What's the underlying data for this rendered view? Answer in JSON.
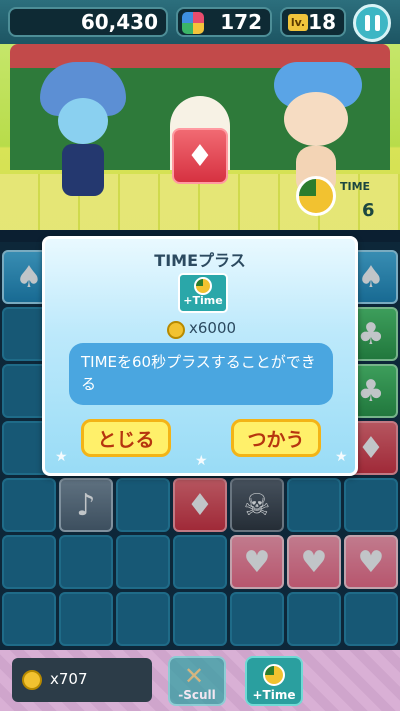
{
  "hud": {
    "score": "60,430",
    "gems": "172",
    "level_tag": "lv.",
    "level": "18"
  },
  "scene": {
    "time_label": "TIME",
    "time_value": "6",
    "tile_symbol": "♦"
  },
  "dialog": {
    "title": "TIMEプラス",
    "item_label": "+Time",
    "cost": "x6000",
    "message": "TIMEを60秒プラスすることができる",
    "close_label": "とじる",
    "use_label": "つかう"
  },
  "board": {
    "pieces": [
      {
        "col": 0,
        "row": 0,
        "kind": "p-blue",
        "symbol": "♠"
      },
      {
        "col": 6,
        "row": 0,
        "kind": "p-blue",
        "symbol": "♠"
      },
      {
        "col": 6,
        "row": 1,
        "kind": "p-green",
        "symbol": "♣"
      },
      {
        "col": 6,
        "row": 2,
        "kind": "p-green",
        "symbol": "♣"
      },
      {
        "col": 6,
        "row": 3,
        "kind": "p-red",
        "symbol": "♦"
      },
      {
        "col": 1,
        "row": 4,
        "kind": "p-note",
        "symbol": "♪"
      },
      {
        "col": 3,
        "row": 4,
        "kind": "p-red",
        "symbol": "♦"
      },
      {
        "col": 4,
        "row": 4,
        "kind": "p-skull",
        "symbol": "☠"
      },
      {
        "col": 4,
        "row": 5,
        "kind": "p-heart",
        "symbol": "♥"
      },
      {
        "col": 5,
        "row": 5,
        "kind": "p-heart",
        "symbol": "♥"
      },
      {
        "col": 6,
        "row": 5,
        "kind": "p-heart",
        "symbol": "♥"
      }
    ]
  },
  "bottom": {
    "coins": "x707",
    "scull_label": "-Scull",
    "time_label": "+Time"
  },
  "icons": {
    "pause": "pause-icon",
    "gem": "gem-icon",
    "coin": "coin-icon",
    "clock": "clock-icon"
  }
}
